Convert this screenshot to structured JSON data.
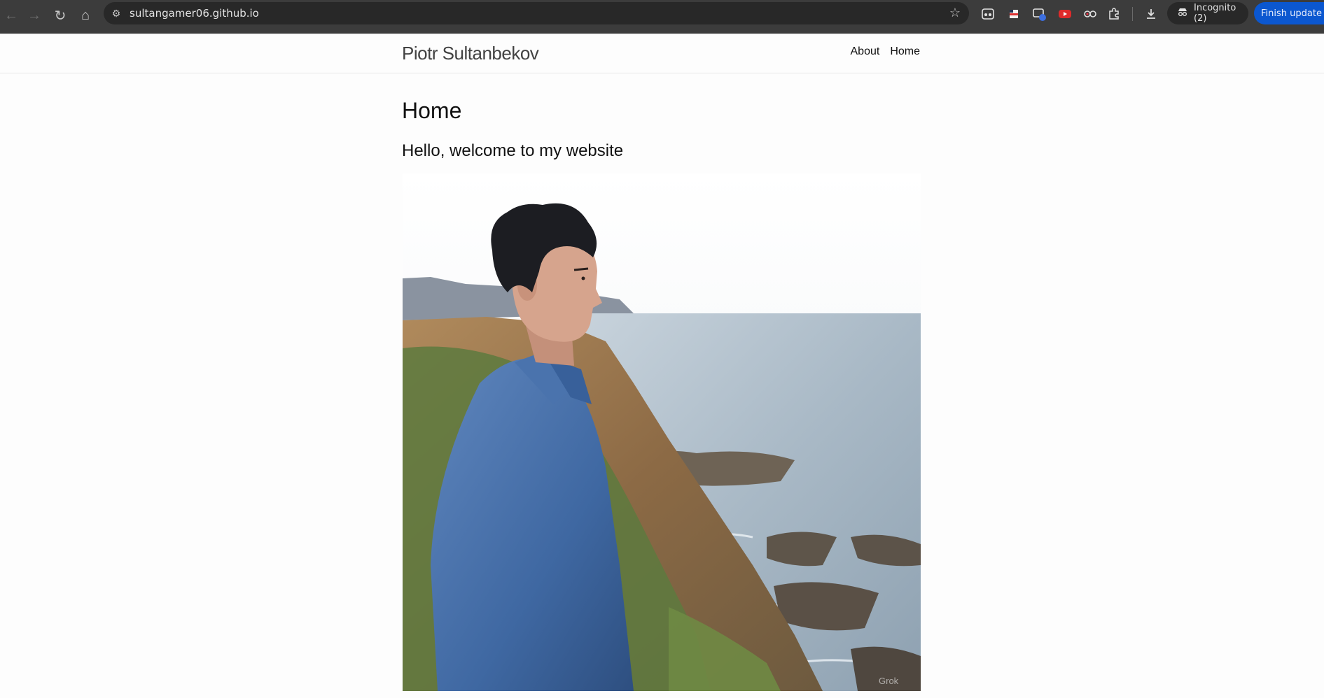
{
  "browser": {
    "url": "sultangamer06.github.io",
    "incognito_label": "Incognito (2)",
    "update_label": "Finish update",
    "icons": [
      "back-icon",
      "forward-icon",
      "reload-icon",
      "home-icon",
      "site-settings-icon",
      "bookmark-star-icon",
      "download-icon",
      "incognito-icon"
    ]
  },
  "site": {
    "title": "Piotr Sultanbekov",
    "nav": [
      {
        "label": "About"
      },
      {
        "label": "Home"
      }
    ]
  },
  "page": {
    "heading": "Home",
    "welcome": "Hello, welcome to my website"
  },
  "colors": {
    "chrome_bg": "#3c3c3c",
    "omnibox_bg": "#282828",
    "update_button": "#0b57d0",
    "page_bg": "#fdfdfd"
  }
}
